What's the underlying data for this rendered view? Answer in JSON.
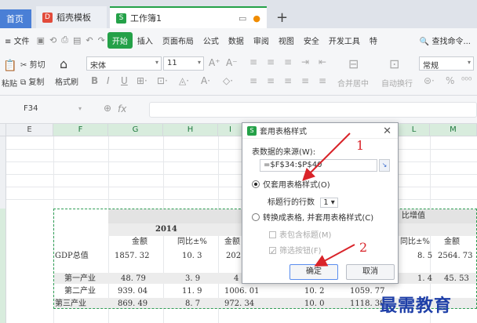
{
  "tabs": {
    "home": "首页",
    "templates": "稻壳模板",
    "workbook": "工作簿1"
  },
  "menu": {
    "file": "文件",
    "start": "开始",
    "insert": "插入",
    "layout": "页面布局",
    "formula": "公式",
    "data": "数据",
    "review": "审阅",
    "view": "视图",
    "security": "安全",
    "devtools": "开发工具",
    "special": "特",
    "search": "查找命令..."
  },
  "ribbon": {
    "cut": "剪切",
    "copy": "复制",
    "format_painter": "格式刷",
    "paste": "粘贴",
    "font_name": "宋体",
    "font_size": "11",
    "merge_center": "合并居中",
    "wrap": "自动换行",
    "number_format": "常规"
  },
  "formula_bar": {
    "name_box": "F34",
    "fx": "fx"
  },
  "columns": [
    "E",
    "F",
    "G",
    "H",
    "I",
    "J",
    "K",
    "L",
    "M"
  ],
  "sheet": {
    "header_right": "比增值",
    "year": "2014",
    "amount": "金额",
    "ratio": "同比±%",
    "rows": [
      {
        "label": "GDP总值",
        "g": "1857. 32",
        "h": "10. 3",
        "i": "202",
        "l": "8. 5",
        "m": "2564. 73"
      },
      {
        "label": "第一产业",
        "g": "48. 79",
        "h": "3. 9",
        "i": "4",
        "l": "1. 4",
        "m": "45. 53"
      },
      {
        "label": "第二产业",
        "g": "939. 04",
        "h": "11. 9",
        "i": "1006. 01",
        "j": "10. 2",
        "k": "1059. 77"
      },
      {
        "label": "第三产业",
        "g": "869. 49",
        "h": "8. 7",
        "i": "972. 34",
        "j": "10. 0",
        "k": "1118. 39"
      }
    ]
  },
  "dialog": {
    "title": "套用表格样式",
    "source_label": "表数据的来源(W):",
    "source_value": "=$F$34:$P$40",
    "option_style_only": "仅套用表格样式(O)",
    "header_rows_label": "标题行的行数",
    "header_rows_value": "1",
    "option_convert": "转换成表格, 并套用表格样式(C)",
    "include_header": "表包含标题(M)",
    "filter_button": "筛选按钮(F)",
    "ok": "确定",
    "cancel": "取消"
  },
  "annotations": {
    "marker1": "1",
    "marker2": "2",
    "watermark": "最需教育"
  },
  "colors": {
    "accent_green": "#24a148",
    "annotation_red": "#d9242a",
    "watermark_blue": "#1e3fa8"
  }
}
